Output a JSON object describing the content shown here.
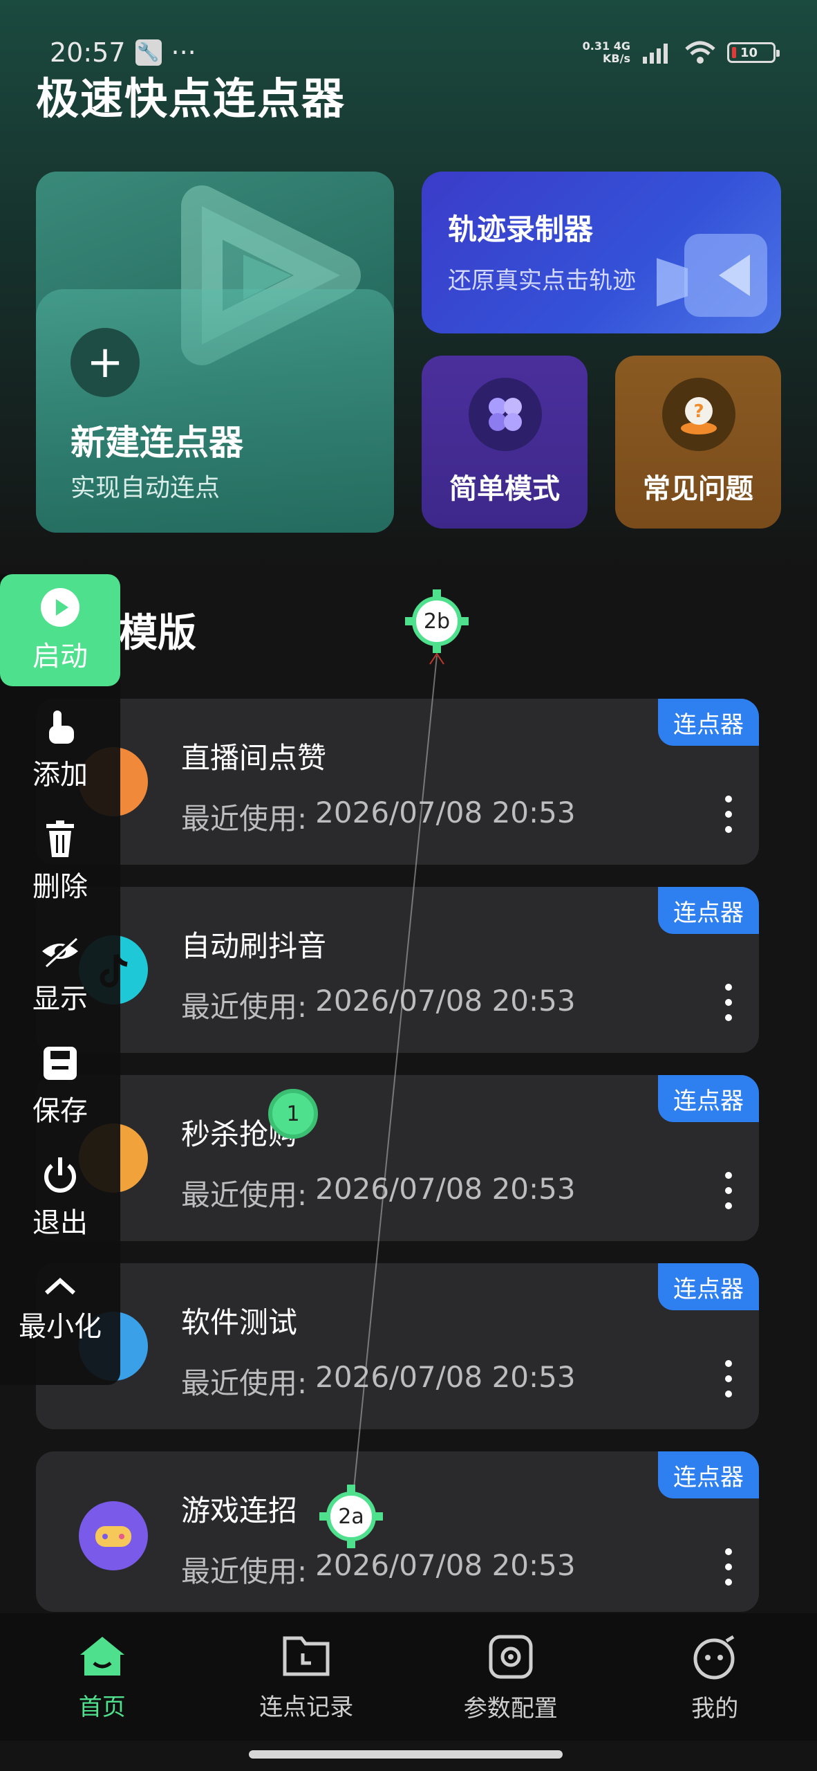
{
  "status_bar": {
    "time": "20:57",
    "dots": "···",
    "net_speed_value": "0.31",
    "net_speed_unit": "KB/s",
    "network_type": "4G",
    "battery_level": "10"
  },
  "app_title": "极速快点连点器",
  "cards": {
    "new_clicker": {
      "title": "新建连点器",
      "subtitle": "实现自动连点",
      "icon": "plus-icon"
    },
    "track_recorder": {
      "title": "轨迹录制器",
      "subtitle": "还原真实点击轨迹",
      "icon": "video-camera-icon"
    },
    "simple_mode": {
      "title": "简单模式",
      "icon": "clover-icon"
    },
    "faq": {
      "title": "常见问题",
      "icon": "question-icon"
    }
  },
  "section_title": "模版",
  "templates": [
    {
      "name": "直播间点赞",
      "recent_label": "最近使用:",
      "recent_time": "2026/07/08 20:53",
      "tag": "连点器",
      "avatar_color": "#f08a3a",
      "icon": "tv-icon"
    },
    {
      "name": "自动刷抖音",
      "recent_label": "最近使用:",
      "recent_time": "2026/07/08 20:53",
      "tag": "连点器",
      "avatar_color": "#1fc8d6",
      "icon": "tiktok-icon"
    },
    {
      "name": "秒杀抢购",
      "recent_label": "最近使用:",
      "recent_time": "2026/07/08 20:53",
      "tag": "连点器",
      "avatar_color": "#f2a23a",
      "icon": "alarm-clock-icon"
    },
    {
      "name": "软件测试",
      "recent_label": "最近使用:",
      "recent_time": "2026/07/08 20:53",
      "tag": "连点器",
      "avatar_color": "#3aa0e8",
      "icon": "software-icon"
    },
    {
      "name": "游戏连招",
      "recent_label": "最近使用:",
      "recent_time": "2026/07/08 20:53",
      "tag": "连点器",
      "avatar_color": "#7a5ae8",
      "icon": "gamepad-icon"
    }
  ],
  "control_panel": {
    "start": "启动",
    "add": "添加",
    "delete": "删除",
    "show": "显示",
    "save": "保存",
    "exit": "退出",
    "minimize": "最小化"
  },
  "markers": {
    "m1": "1",
    "m2a": "2a",
    "m2b": "2b"
  },
  "bottom_nav": [
    {
      "label": "首页",
      "icon": "home-icon",
      "active": true
    },
    {
      "label": "连点记录",
      "icon": "folder-clock-icon",
      "active": false
    },
    {
      "label": "参数配置",
      "icon": "settings-icon",
      "active": false
    },
    {
      "label": "我的",
      "icon": "profile-face-icon",
      "active": false
    }
  ],
  "colors": {
    "accent": "#4fe08d",
    "tag_blue": "#2e7ff0",
    "card_bg": "#2a2a2c"
  }
}
